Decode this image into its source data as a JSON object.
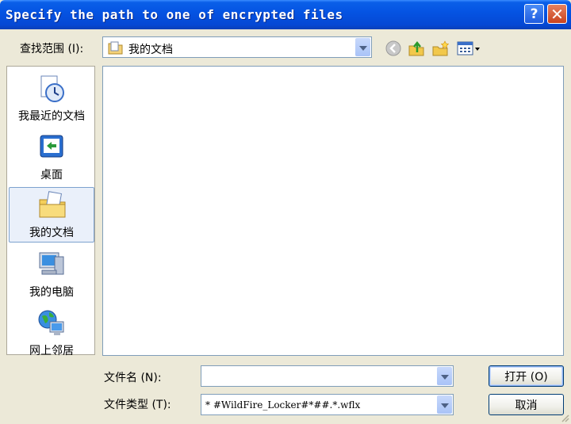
{
  "window": {
    "title": "Specify the path to one of encrypted files",
    "help_glyph": "?",
    "close_glyph": "✕"
  },
  "lookin": {
    "label": "查找范围 (I):",
    "value": "我的文档"
  },
  "places": [
    {
      "label": "我最近的文档",
      "icon": "recent-documents-icon"
    },
    {
      "label": "桌面",
      "icon": "desktop-icon"
    },
    {
      "label": "我的文档",
      "icon": "my-documents-icon"
    },
    {
      "label": "我的电脑",
      "icon": "my-computer-icon"
    },
    {
      "label": "网上邻居",
      "icon": "network-places-icon"
    }
  ],
  "filename": {
    "label": "文件名 (N):",
    "value": ""
  },
  "filetype": {
    "label": "文件类型 (T):",
    "value": "* #WildFire_Locker#*##.*.wflx"
  },
  "buttons": {
    "open": "打开 (O)",
    "cancel": "取消"
  },
  "colors": {
    "titlebar": "#0554e3",
    "dialog_bg": "#ece9d8",
    "border": "#7f9db9"
  }
}
